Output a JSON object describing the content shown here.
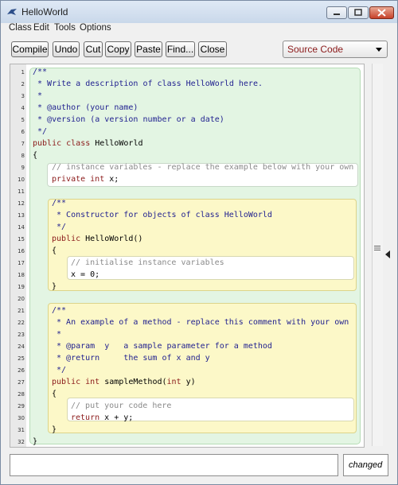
{
  "window": {
    "title": "HelloWorld"
  },
  "menu": [
    "Class",
    "Edit",
    "Tools",
    "Options"
  ],
  "toolbar": {
    "compile": "Compile",
    "undo": "Undo",
    "cut": "Cut",
    "copy": "Copy",
    "paste": "Paste",
    "find": "Find...",
    "close": "Close",
    "view_select": "Source Code"
  },
  "editor": {
    "line_numbers": [
      "1",
      "2",
      "3",
      "4",
      "5",
      "6",
      "7",
      "8",
      "9",
      "10",
      "11",
      "12",
      "13",
      "14",
      "15",
      "16",
      "17",
      "18",
      "19",
      "20",
      "21",
      "22",
      "23",
      "24",
      "25",
      "26",
      "27",
      "28",
      "29",
      "30",
      "31",
      "32"
    ],
    "lines": {
      "l1": "/**",
      "l2": " * Write a description of class HelloWorld here.",
      "l3": " *",
      "l4": " * @author (your name)",
      "l5": " * @version (a version number or a date)",
      "l6": " */",
      "l7a": "public class ",
      "l7b": "HelloWorld",
      "l8": "{",
      "l9": "// instance variables - replace the example below with your own",
      "l10a": "private int ",
      "l10b": "x;",
      "l12": "/**",
      "l13": " * Constructor for objects of class HelloWorld",
      "l14": " */",
      "l15a": "public ",
      "l15b": "HelloWorld()",
      "l16": "{",
      "l17": "// initialise instance variables",
      "l18": "x = 0;",
      "l19": "}",
      "l21": "/**",
      "l22": " * An example of a method - replace this comment with your own",
      "l23": " *",
      "l24": " * @param  y   a sample parameter for a method",
      "l25": " * @return     the sum of x and y",
      "l26": " */",
      "l27a": "public int ",
      "l27b": "sampleMethod(",
      "l27c": "int ",
      "l27d": "y)",
      "l28": "{",
      "l29": "// put your code here",
      "l30a": "return ",
      "l30b": "x + y;",
      "l31": "}",
      "l32": "}"
    }
  },
  "status": {
    "message": "",
    "changed": "changed"
  },
  "colors": {
    "class_scope": "#e3f5e3",
    "method_scope": "#fcf8c8",
    "body_scope": "#ffffff",
    "keyword": "#8b1a1a",
    "comment": "#1f1f8f"
  }
}
